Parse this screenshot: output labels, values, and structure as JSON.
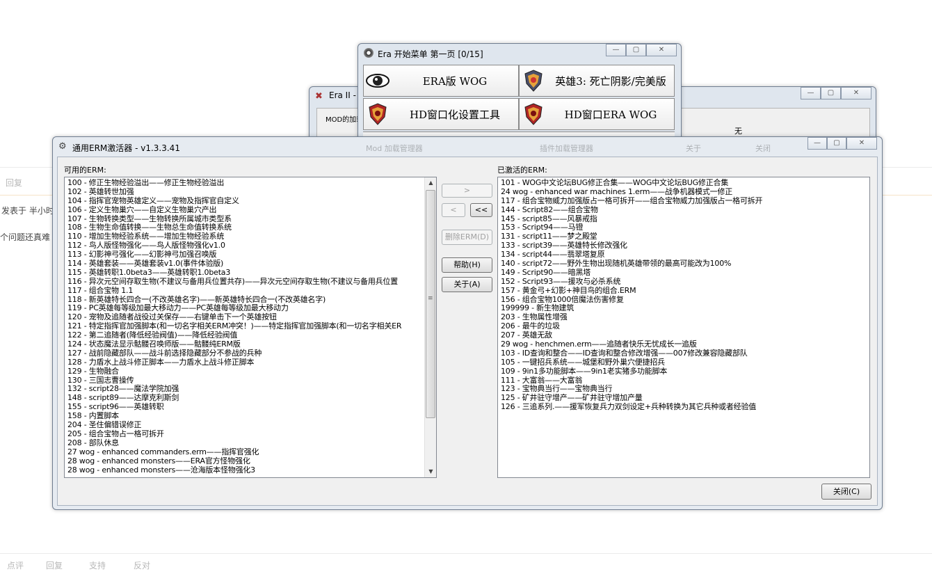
{
  "background": {
    "reply_label": "回复",
    "posted_label": "发表于 半小时",
    "question_label": "个问题还真难",
    "footer": [
      "点评",
      "回复",
      "支持",
      "反对"
    ]
  },
  "era2": {
    "title": "Era II -",
    "label": "MOD的加载",
    "value": "无",
    "faded": [
      "Mod 加载管理器",
      "插件加载管理器",
      "关于",
      "关闭"
    ]
  },
  "era_menu": {
    "title": "Era 开始菜单 第一页  [0/15]",
    "buttons": [
      {
        "label": "ERA版 WOG",
        "icon": "eye-icon"
      },
      {
        "label": "英雄3: 死亡阴影/完美版",
        "icon": "shield-icon"
      },
      {
        "label": "HD窗口化设置工具",
        "icon": "shield-icon"
      },
      {
        "label": "HD窗口ERA WOG",
        "icon": "shield-icon"
      }
    ]
  },
  "erm": {
    "title": "通用ERM激活器 - v1.3.3.41",
    "available_label": "可用的ERM:",
    "active_label": "已激活的ERM:",
    "buttons": {
      "add": ">",
      "remove": "<",
      "remove_all": "<<",
      "delete": "删除ERM(D)",
      "help": "帮助(H)",
      "about": "关于(A)",
      "close": "关闭(C)"
    },
    "available": [
      "100 - 修正生物经验溢出——修正生物经验溢出",
      "102 - 英雄转世加强",
      "104 - 指挥官宠物英雄定义——宠物及指挥官自定义",
      "106 - 定义生物巢穴——自定义生物巢穴产出",
      "107 - 生物转换类型——生物转换所属城市类型系",
      "108 - 生物生命值转换——生物总生命值转换系统",
      "110 - 增加生物经验系统——增加生物经验系统",
      "112 - 鸟人版怪物强化——鸟人版怪物强化v1.0",
      "113 - 幻影神弓强化——幻影神弓加强召唤版",
      "114 - 英雄套装——英雄套装v1.0(事件体验版)",
      "115 - 英雄转职1.0beta3——英雄转职1.0beta3",
      "116 - 异次元空间存取生物(不建议与备用兵位置共存)——异次元空间存取生物(不建议与备用兵位置",
      "117 - 组合宝物 1.1",
      "118 - 新英雄特长四合一(不改英雄名字)——新英雄特长四合一(不改英雄名字)",
      "119 - PC英雄每等级加最大移动力——PC英雄每等级加最大移动力",
      "120 - 宠物及追随者战役过关保存——右键单击下一个英雄按钮",
      "121 - 特定指挥官加强脚本(和一切名字相关ERM冲突！)——特定指挥官加强脚本(和一切名字相关ER",
      "122 - 第二追随者(降低经验阀值)——降低经验阀值",
      "124 - 状态魔法显示骷髅召唤师版——骷髅纯ERM版",
      "127 - 战前隐藏部队——战斗前选择隐藏部分不参战的兵种",
      "128 - 力盾水上战斗修正脚本——力盾水上战斗修正脚本",
      "129 - 生物融合",
      "130 - 三国志曹操传",
      "132 - script28——魔法学院加强",
      "148 - script89——达摩克利斯剑",
      "155 - script96——英雄转职",
      "158 - 内置脚本",
      "204 - 圣住偏错误修正",
      "205 - 组合宝物占一格可拆开",
      "208 - 部队休息",
      "27 wog - enhanced commanders.erm——指挥官强化",
      "28 wog - enhanced monsters——ERA官方怪物强化",
      "28 wog - enhanced monsters——沧海版本怪物强化3"
    ],
    "active": [
      "101 - WOG中文论坛BUG修正合集——WOG中文论坛BUG修正合集",
      "24 wog - enhanced war machines 1.erm——战争机器模式一修正",
      "117 - 组合宝物威力加强版占一格可拆开——组合宝物威力加强版占一格可拆开",
      "144 - Script82——组合宝物",
      "145 - script85——风暴戒指",
      "153 - Script94——马镫",
      "131 - script11——梦之殿堂",
      "133 - script39——英雄特长修改强化",
      "134 - script44——翡翠塔复原",
      "140 - script72——野外生物出现随机英雄带领的最高可能改为100%",
      "149 - Script90——暗黑塔",
      "152 - Script93——援攻与必杀系统",
      "157 - 黄金弓+幻影+神目鸟的组合.ERM",
      "156 - 组合宝物1000倍魔法伤害修复",
      "199999 - 新生物建筑",
      "203 - 生物属性增强",
      "206 - 最牛的垃圾",
      "207 - 英雄无敌",
      "29 wog - henchmen.erm——追随者快乐无忧成长一追版",
      "103 - ID查询和整合——ID查询和整合修改增强——007修改兼容隐藏部队",
      "105 - 一键招兵系统——城堡和野外巢穴便捷招兵",
      "109 - 9in1多功能脚本——9in1老实猪多功能脚本",
      "111 - 大富翁——大富翁",
      "123 - 宝物典当行——宝物典当行",
      "125 - 矿井驻守增产——矿井驻守增加产量",
      "126 - 三追系列.——援军恢复兵力双剑设定+兵种转换为其它兵种或者经验值"
    ]
  }
}
